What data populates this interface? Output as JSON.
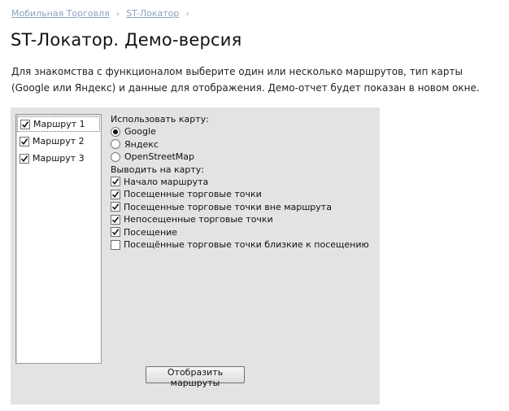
{
  "breadcrumb": {
    "items": [
      "Мобильная Торговля",
      "ST-Локатор"
    ],
    "separator": "›"
  },
  "page": {
    "title": "ST-Локатор. Демо-версия",
    "intro": "Для знакомства с функционалом выберите один или несколько маршрутов, тип карты (Google или Яндекс) и данные для отображения. Демо-отчет будет показан в новом окне."
  },
  "routes": [
    {
      "label": "Маршрут 1",
      "checked": true,
      "focused": true
    },
    {
      "label": "Маршрут 2",
      "checked": true,
      "focused": false
    },
    {
      "label": "Маршрут 3",
      "checked": true,
      "focused": false
    }
  ],
  "map": {
    "label": "Использовать карту:",
    "options": [
      {
        "label": "Google",
        "selected": true
      },
      {
        "label": "Яндекс",
        "selected": false
      },
      {
        "label": "OpenStreetMap",
        "selected": false
      }
    ]
  },
  "display": {
    "label": "Выводить на карту:",
    "options": [
      {
        "label": "Начало маршрута",
        "checked": true
      },
      {
        "label": "Посещенные торговые точки",
        "checked": true
      },
      {
        "label": "Посещенные торговые точки вне маршрута",
        "checked": true
      },
      {
        "label": "Непосещенные торговые точки",
        "checked": true
      },
      {
        "label": "Посещение",
        "checked": true
      },
      {
        "label": "Посещённые торговые точки близкие к посещению",
        "checked": false
      }
    ]
  },
  "actions": {
    "show_routes_label": "Отобразить маршруты"
  }
}
